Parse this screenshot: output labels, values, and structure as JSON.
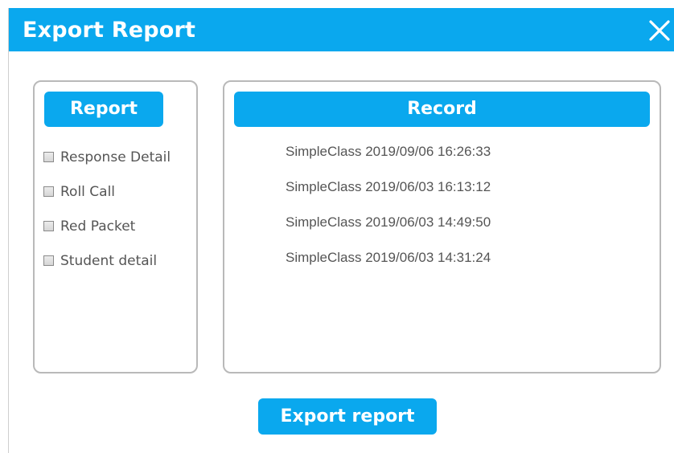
{
  "window": {
    "title": "Export Report",
    "close_icon": "close-icon"
  },
  "report": {
    "header": "Report",
    "options": [
      {
        "label": "Response Detail",
        "checked": false
      },
      {
        "label": "Roll Call",
        "checked": false
      },
      {
        "label": "Red Packet",
        "checked": false
      },
      {
        "label": "Student detail",
        "checked": false
      }
    ]
  },
  "record": {
    "header": "Record",
    "items": [
      "SimpleClass 2019/09/06 16:26:33",
      "SimpleClass 2019/06/03 16:13:12",
      "SimpleClass 2019/06/03 14:49:50",
      "SimpleClass 2019/06/03 14:31:24"
    ]
  },
  "actions": {
    "export_label": "Export report"
  },
  "colors": {
    "accent": "#0aa8ee",
    "text": "#555555",
    "border": "#b9b9b9"
  }
}
